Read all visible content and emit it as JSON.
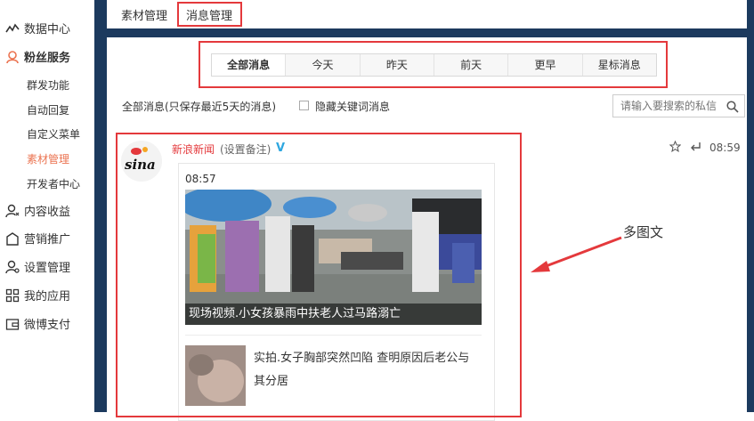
{
  "sidebar": {
    "top": {
      "label": "数据中心",
      "icon": "trend-icon"
    },
    "groups": [
      {
        "label": "粉丝服务",
        "icon": "fans-icon",
        "active": true
      },
      {
        "label": "内容收益",
        "icon": "user-income-icon"
      },
      {
        "label": "营销推广",
        "icon": "shop-icon"
      },
      {
        "label": "设置管理",
        "icon": "user-settings-icon"
      },
      {
        "label": "我的应用",
        "icon": "grid-icon"
      },
      {
        "label": "微博支付",
        "icon": "wallet-icon"
      }
    ],
    "subitems": [
      {
        "label": "群发功能"
      },
      {
        "label": "自动回复"
      },
      {
        "label": "自定义菜单"
      },
      {
        "label": "素材管理",
        "active": true
      },
      {
        "label": "开发者中心"
      }
    ]
  },
  "tabs": {
    "material": "素材管理",
    "messages": "消息管理"
  },
  "filters": [
    "全部消息",
    "今天",
    "昨天",
    "前天",
    "更早",
    "星标消息"
  ],
  "info": {
    "summary": "全部消息(只保存最近5天的消息)",
    "hide_keywords": "隐藏关键词消息",
    "search_placeholder": "请输入要搜索的私信"
  },
  "message": {
    "sender": "新浪新闻",
    "remark": "(设置备注)",
    "verified": "V",
    "time": "08:59",
    "card": {
      "time": "08:57",
      "headline": "现场视频.小女孩暴雨中扶老人过马路溺亡",
      "article_title": "实拍.女子胸部突然凹陷 查明原因后老公与其分居"
    }
  },
  "annotation": "多图文",
  "colors": {
    "accent": "#eb7350",
    "frame": "#1c3a5e",
    "highlight": "#e4393c"
  }
}
